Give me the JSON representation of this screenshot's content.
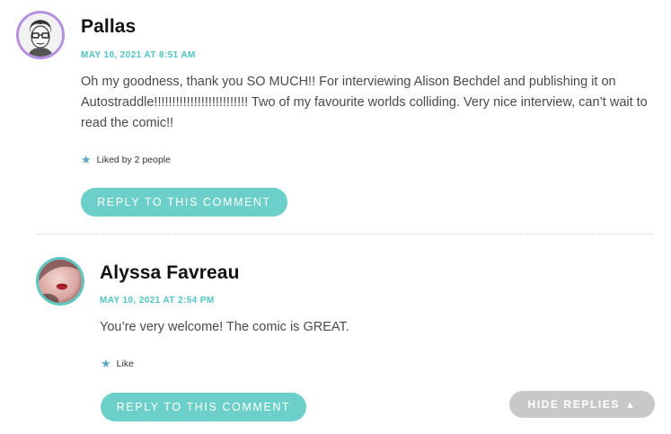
{
  "comments": [
    {
      "author": "Pallas",
      "date": "MAY 10, 2021 AT 8:51 AM",
      "text": "Oh my goodness, thank you SO MUCH!! For interviewing Alison Bechdel and publishing it on Autostraddle!!!!!!!!!!!!!!!!!!!!!!!!!! Two of my favourite worlds colliding. Very nice interview, can’t wait to read the comic!!",
      "likes_label": "Liked by 2 people",
      "reply_label": "REPLY TO THIS COMMENT",
      "avatar_ring_color": "#b58fe0"
    },
    {
      "author": "Alyssa Favreau",
      "date": "MAY 10, 2021 AT 2:54 PM",
      "text": "You’re very welcome! The comic is GREAT.",
      "likes_label": "Like",
      "reply_label": "REPLY TO THIS COMMENT",
      "avatar_ring_color": "#5cc6c1"
    }
  ],
  "hide_replies_label": "HIDE REPLIES",
  "icons": {
    "like": "star-icon",
    "hide": "caret-up-icon"
  },
  "colors": {
    "accent": "#4fc3c3",
    "reply_button": "#6ccfca",
    "hide_button": "#c8c8c8",
    "like_star": "#5aa7c9"
  }
}
